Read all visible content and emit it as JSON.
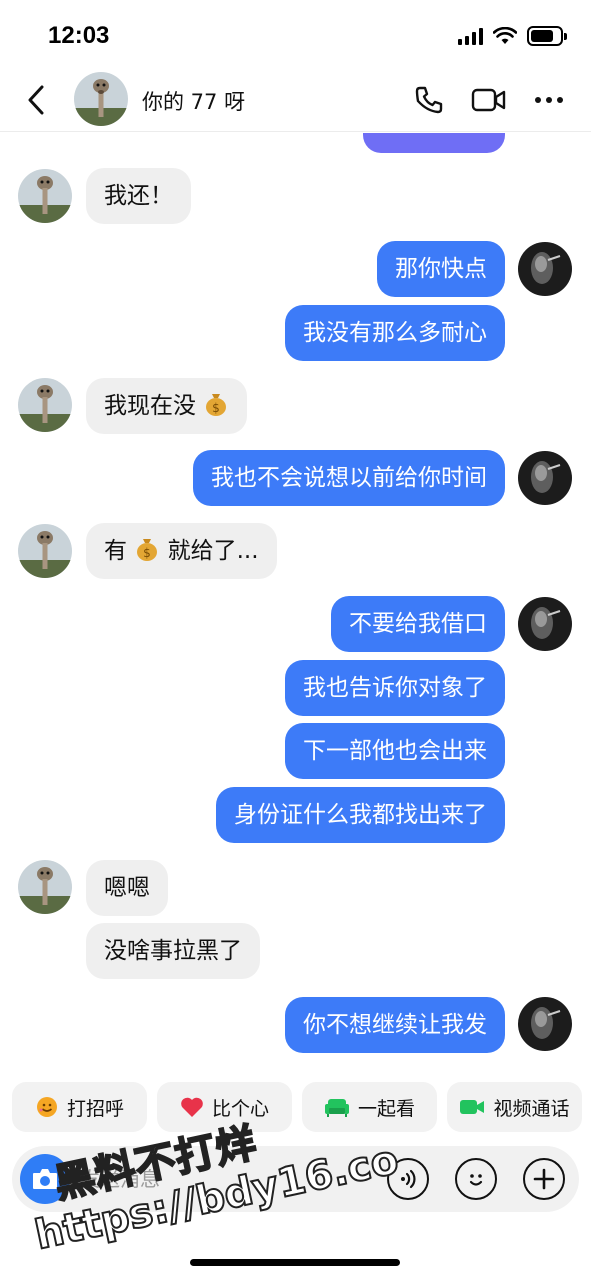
{
  "status_bar": {
    "time": "12:03"
  },
  "header": {
    "contact_name": "你的 77 呀"
  },
  "messages": [
    {
      "side": "in",
      "text": "我还！"
    },
    {
      "side": "out",
      "text": "那你快点"
    },
    {
      "side": "out",
      "text": "我没有那么多耐心"
    },
    {
      "side": "in",
      "text": "我现在没",
      "emoji": "money-bag"
    },
    {
      "side": "out",
      "text": "我也不会说想以前给你时间"
    },
    {
      "side": "in",
      "text_before": "有",
      "emoji": "money-bag",
      "text": "就给了..."
    },
    {
      "side": "out",
      "text": "不要给我借口"
    },
    {
      "side": "out",
      "text": "我也告诉你对象了"
    },
    {
      "side": "out",
      "text": "下一部他也会出来"
    },
    {
      "side": "out",
      "text": "身份证什么我都找出来了"
    },
    {
      "side": "in",
      "text": "嗯嗯"
    },
    {
      "side": "in",
      "text": "没啥事拉黑了"
    },
    {
      "side": "out",
      "text": "你不想继续让我发"
    }
  ],
  "quick_replies": [
    {
      "label": "打招呼",
      "icon": "smile-wave-icon",
      "color": "#f5a623"
    },
    {
      "label": "比个心",
      "icon": "heart-icon",
      "color": "#e8334a"
    },
    {
      "label": "一起看",
      "icon": "sofa-icon",
      "color": "#22c35e"
    },
    {
      "label": "视频通话",
      "icon": "video-camera-icon",
      "color": "#22c35e"
    }
  ],
  "composer": {
    "placeholder": "发送消息"
  },
  "watermark": {
    "line1": "黑料不打烊",
    "line2": "https://bdy16.co"
  },
  "colors": {
    "outgoing_bubble": "#3d7bf8",
    "incoming_bubble": "#efefef",
    "camera_button": "#2f7df6"
  }
}
